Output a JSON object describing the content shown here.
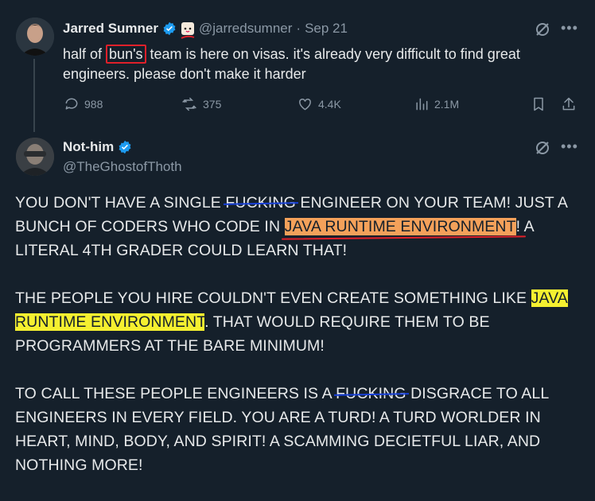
{
  "tweet1": {
    "name": "Jarred Sumner",
    "handle": "@jarredsumner",
    "separator": "·",
    "date": "Sep 21",
    "text_before": "half of ",
    "text_circled": "bun's",
    "text_line1_after": " team is here on visas. it's already very difficult to find great",
    "text_line2": "engineers. please don't make it harder",
    "stats": {
      "replies": "988",
      "reposts": "375",
      "likes": "4.4K",
      "views": "2.1M"
    }
  },
  "tweet2": {
    "name": "Not-him",
    "handle": "@TheGhostofThoth",
    "p1": {
      "a": "YOU DON'T HAVE A SINGLE ",
      "scratched": "FUCKING",
      "b": " ENGINEER ON YOUR TEAM! JUST A BUNCH OF CODERS WHO CODE IN ",
      "highlight": "JAVA RUNTIME ENVIRONMENT",
      "c": "! A LITERAL 4TH GRADER COULD LEARN THAT!"
    },
    "p2": {
      "a": "THE PEOPLE YOU HIRE COULDN'T EVEN CREATE SOMETHING LIKE ",
      "highlight": "JAVA RUNTIME ENVIRONMENT",
      "b": ". THAT WOULD REQUIRE THEM TO BE PROGRAMMERS AT THE BARE MINIMUM!"
    },
    "p3": {
      "a": "TO CALL THESE PEOPLE ENGINEERS IS A ",
      "scratched": "FUCKING",
      "b": " DISGRACE TO ALL ENGINEERS IN EVERY FIELD. YOU ARE A TURD! A TURD WORLDER IN HEART, MIND, BODY, AND SPIRIT! A SCAMMING DECIETFUL LIAR, AND NOTHING MORE!"
    }
  },
  "colors": {
    "background": "#15202b",
    "verified": "#1d9bf0",
    "muted": "#8b98a5",
    "highlight_orange": "#f4a15a",
    "highlight_yellow": "#f5f030"
  }
}
